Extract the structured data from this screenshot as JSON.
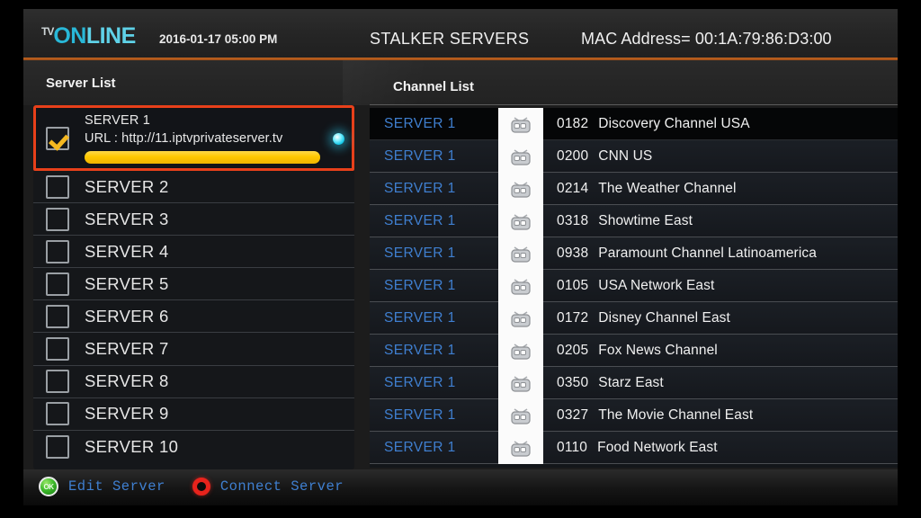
{
  "header": {
    "logo_tv": "TV",
    "logo_on": "ON",
    "logo_line": "LINE",
    "datetime": "2016-01-17 05:00 PM",
    "stalker_title": "STALKER SERVERS",
    "mac_address": "MAC Address= 00:1A:79:86:D3:00",
    "accent_color": "#c4651f"
  },
  "panels": {
    "server_list_title": "Server List",
    "channel_list_title": "Channel List"
  },
  "server_list": {
    "selected_index": 0,
    "selection_border_color": "#e8401a",
    "progress_color": "#ffc800",
    "items": [
      {
        "label": "SERVER 1",
        "url": "URL : http://11.iptvprivateserver.tv",
        "checked": true,
        "selected": true
      },
      {
        "label": "SERVER 2",
        "checked": false,
        "selected": false
      },
      {
        "label": "SERVER 3",
        "checked": false,
        "selected": false
      },
      {
        "label": "SERVER 4",
        "checked": false,
        "selected": false
      },
      {
        "label": "SERVER 5",
        "checked": false,
        "selected": false
      },
      {
        "label": "SERVER 6",
        "checked": false,
        "selected": false
      },
      {
        "label": "SERVER 7",
        "checked": false,
        "selected": false
      },
      {
        "label": "SERVER 8",
        "checked": false,
        "selected": false
      },
      {
        "label": "SERVER 9",
        "checked": false,
        "selected": false
      },
      {
        "label": "SERVER 10",
        "checked": false,
        "selected": false
      }
    ]
  },
  "channel_list": {
    "server_label_color": "#3f7fd0",
    "active_index": 0,
    "rows": [
      {
        "server": "SERVER 1",
        "number": "0182",
        "name": "Discovery Channel USA",
        "active": true
      },
      {
        "server": "SERVER 1",
        "number": "0200",
        "name": "CNN US",
        "active": false
      },
      {
        "server": "SERVER 1",
        "number": "0214",
        "name": "The Weather Channel",
        "active": false
      },
      {
        "server": "SERVER 1",
        "number": "0318",
        "name": "Showtime East",
        "active": false
      },
      {
        "server": "SERVER 1",
        "number": "0938",
        "name": "Paramount Channel Latinoamerica",
        "active": false
      },
      {
        "server": "SERVER 1",
        "number": "0105",
        "name": "USA Network East",
        "active": false
      },
      {
        "server": "SERVER 1",
        "number": "0172",
        "name": "Disney Channel East",
        "active": false
      },
      {
        "server": "SERVER 1",
        "number": "0205",
        "name": "Fox News Channel",
        "active": false
      },
      {
        "server": "SERVER 1",
        "number": "0350",
        "name": "Starz East",
        "active": false
      },
      {
        "server": "SERVER 1",
        "number": "0327",
        "name": "The Movie Channel East",
        "active": false
      },
      {
        "server": "SERVER 1",
        "number": "0110",
        "name": "Food Network East",
        "active": false
      }
    ]
  },
  "footer": {
    "buttons": [
      {
        "key": "OK",
        "key_type": "ok-green",
        "label": "Edit Server",
        "color": "#3fbb2c"
      },
      {
        "key": "",
        "key_type": "ring-red",
        "label": "Connect Server",
        "color": "#e8231c"
      }
    ]
  }
}
